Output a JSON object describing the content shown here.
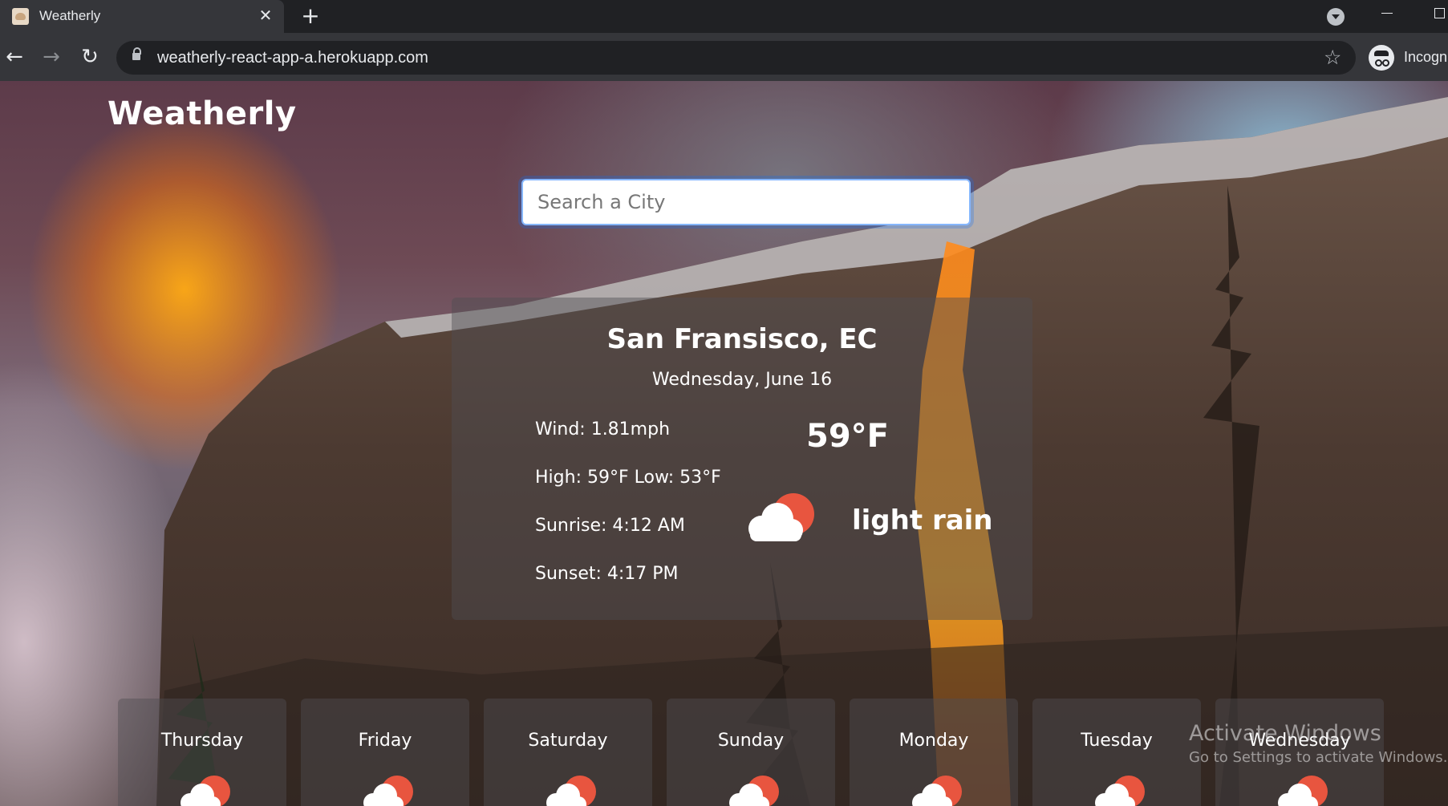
{
  "browser": {
    "tab_title": "Weatherly",
    "tab_close": "✕",
    "new_tab": "+",
    "url": "weatherly-react-app-a.herokuapp.com",
    "profile_label": "Incognito"
  },
  "app": {
    "brand": "Weatherly",
    "search_placeholder": "Search a City"
  },
  "current": {
    "city": "San Fransisco, EC",
    "date": "Wednesday, June 16",
    "wind": "Wind: 1.81mph",
    "high_low": "High: 59°F Low: 53°F",
    "sunrise": "Sunrise: 4:12 AM",
    "sunset": "Sunset: 4:17 PM",
    "temp": "59°F",
    "description": "light rain",
    "icon": "cloud-sun-rain-icon"
  },
  "forecast": [
    {
      "day": "Thursday",
      "icon": "cloud-sun-icon"
    },
    {
      "day": "Friday",
      "icon": "cloud-sun-icon"
    },
    {
      "day": "Saturday",
      "icon": "cloud-sun-icon"
    },
    {
      "day": "Sunday",
      "icon": "cloud-sun-icon"
    },
    {
      "day": "Monday",
      "icon": "cloud-sun-icon"
    },
    {
      "day": "Tuesday",
      "icon": "cloud-sun-icon"
    },
    {
      "day": "Wednesday",
      "icon": "cloud-sun-icon"
    }
  ],
  "watermark": {
    "line1": "Activate Windows",
    "line2": "Go to Settings to activate Windows."
  },
  "colors": {
    "card_bg": "rgba(80,78,82,0.45)",
    "sun": "#e8553f",
    "cloud": "#ffffff",
    "focus_ring": "#86b7fe"
  }
}
